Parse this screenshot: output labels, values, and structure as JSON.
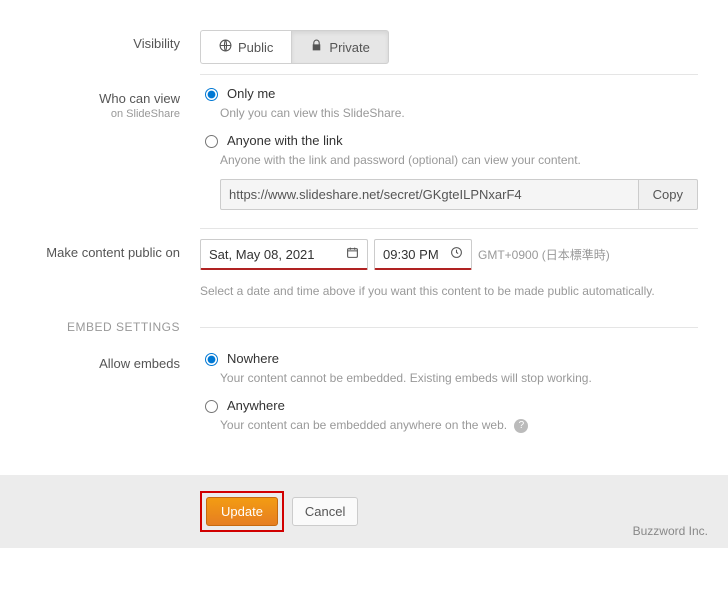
{
  "visibility": {
    "label": "Visibility",
    "options": {
      "public": "Public",
      "private": "Private"
    },
    "selected": "private"
  },
  "who_can_view": {
    "label": "Who can view",
    "sublabel": "on SlideShare",
    "options": [
      {
        "value": "only_me",
        "label": "Only me",
        "hint": "Only you can view this SlideShare.",
        "selected": true
      },
      {
        "value": "anyone_link",
        "label": "Anyone with the link",
        "hint": "Anyone with the link and password (optional) can view your content.",
        "selected": false
      }
    ],
    "secret_url": "https://www.slideshare.net/secret/GKgteILPNxarF4",
    "copy_label": "Copy"
  },
  "schedule": {
    "label": "Make content public on",
    "date": "Sat, May 08, 2021",
    "time": "09:30 PM",
    "timezone": "GMT+0900 (日本標準時)",
    "hint": "Select a date and time above if you want this content to be made public automatically."
  },
  "embed_section": {
    "header": "EMBED SETTINGS",
    "label": "Allow embeds",
    "options": [
      {
        "value": "nowhere",
        "label": "Nowhere",
        "hint": "Your content cannot be embedded. Existing embeds will stop working.",
        "selected": true
      },
      {
        "value": "anywhere",
        "label": "Anywhere",
        "hint": "Your content can be embedded anywhere on the web.",
        "selected": false
      }
    ]
  },
  "footer": {
    "update": "Update",
    "cancel": "Cancel",
    "brand": "Buzzword Inc."
  }
}
